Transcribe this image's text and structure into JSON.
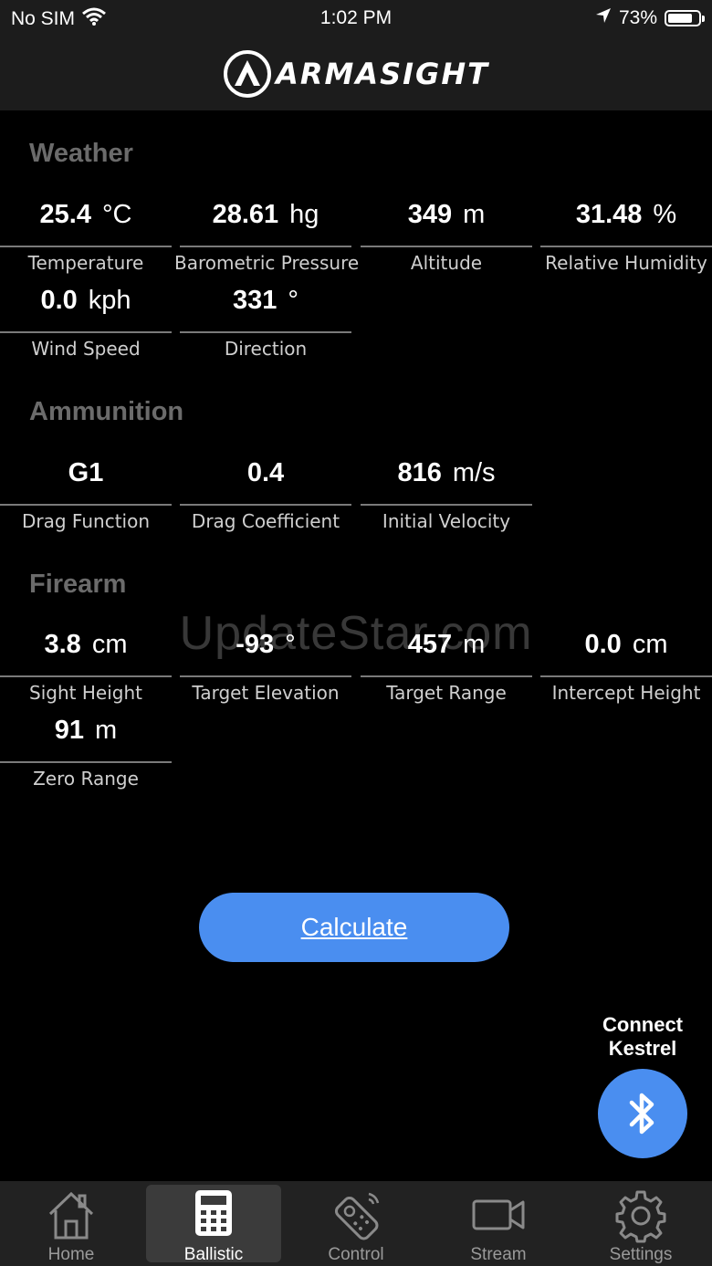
{
  "status_bar": {
    "carrier": "No SIM",
    "time": "1:02 PM",
    "battery": "73%"
  },
  "brand": {
    "name": "ARMASIGHT"
  },
  "weather": {
    "title": "Weather",
    "fields": [
      {
        "value": "25.4",
        "unit": "°C",
        "label": "Temperature"
      },
      {
        "value": "28.61",
        "unit": "hg",
        "label": "Barometric Pressure"
      },
      {
        "value": "349",
        "unit": "m",
        "label": "Altitude"
      },
      {
        "value": "31.48",
        "unit": "%",
        "label": "Relative Humidity"
      },
      {
        "value": "0.0",
        "unit": "kph",
        "label": "Wind Speed"
      },
      {
        "value": "331",
        "unit": "°",
        "label": "Direction"
      }
    ]
  },
  "ammunition": {
    "title": "Ammunition",
    "fields": [
      {
        "value": "G1",
        "unit": "",
        "label": "Drag Function"
      },
      {
        "value": "0.4",
        "unit": "",
        "label": "Drag Coefficient"
      },
      {
        "value": "816",
        "unit": "m/s",
        "label": "Initial Velocity"
      }
    ]
  },
  "firearm": {
    "title": "Firearm",
    "fields": [
      {
        "value": "3.8",
        "unit": "cm",
        "label": "Sight Height"
      },
      {
        "value": "-93",
        "unit": "°",
        "label": "Target Elevation"
      },
      {
        "value": "457",
        "unit": "m",
        "label": "Target Range"
      },
      {
        "value": "0.0",
        "unit": "cm",
        "label": "Intercept Height"
      },
      {
        "value": "91",
        "unit": "m",
        "label": "Zero Range"
      }
    ]
  },
  "watermark": "UpdateStar.com",
  "calculate_label": "Calculate",
  "kestrel": {
    "line1": "Connect",
    "line2": "Kestrel"
  },
  "tabs": [
    {
      "label": "Home"
    },
    {
      "label": "Ballistic"
    },
    {
      "label": "Control"
    },
    {
      "label": "Stream"
    },
    {
      "label": "Settings"
    }
  ],
  "colors": {
    "accent": "#4a8ef0",
    "section_title": "#6b6b6b",
    "background": "#000000",
    "bar": "#1c1c1c"
  }
}
